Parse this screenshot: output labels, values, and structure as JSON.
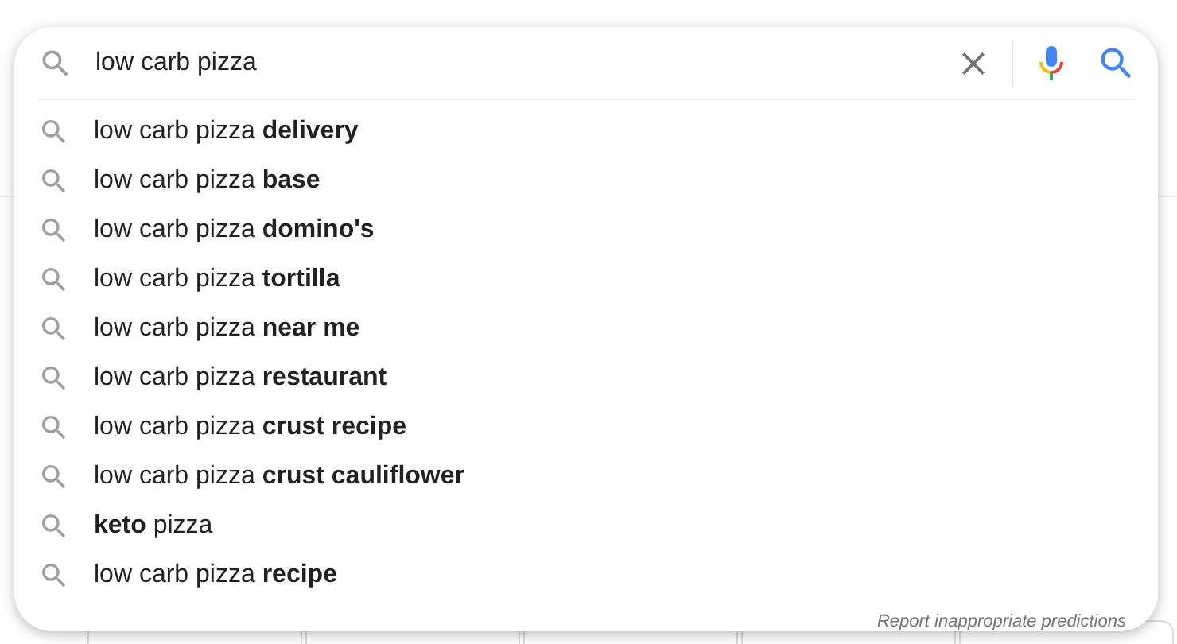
{
  "search": {
    "value": "low carb pizza"
  },
  "suggestions": [
    {
      "text": "low carb pizza **delivery**"
    },
    {
      "text": "low carb pizza **base**"
    },
    {
      "text": "low carb pizza **domino's**"
    },
    {
      "text": "low carb pizza **tortilla**"
    },
    {
      "text": "low carb pizza **near me**"
    },
    {
      "text": "low carb pizza **restaurant**"
    },
    {
      "text": "low carb pizza **crust recipe**"
    },
    {
      "text": "low carb pizza **crust cauliflower**"
    },
    {
      "text": "**keto** pizza"
    },
    {
      "text": "low carb pizza **recipe**"
    }
  ],
  "footer": {
    "report_link": "Report inappropriate predictions"
  }
}
